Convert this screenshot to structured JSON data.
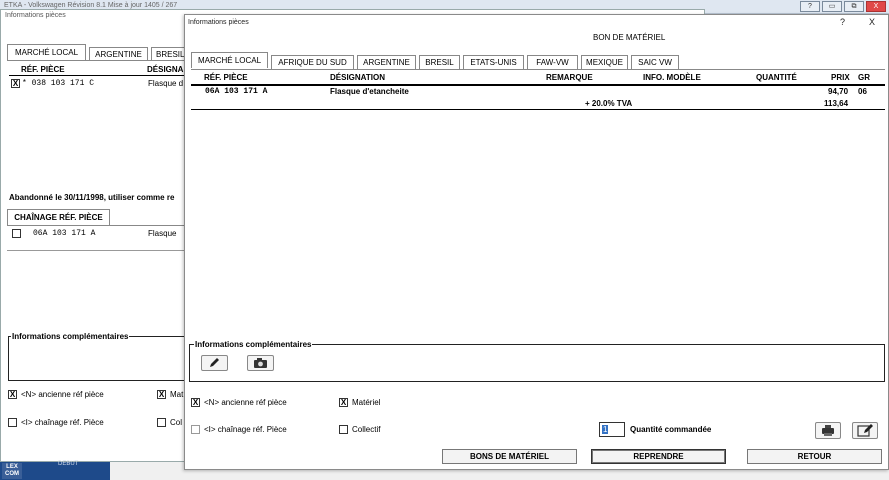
{
  "app": {
    "title": "ETKA - Volkswagen Révision 8.1 Mise à jour 1405 / 267",
    "controls": [
      "?",
      "▭",
      "⧉",
      "X"
    ],
    "logo": "LEX COM",
    "taskbar_label": "DEBUT"
  },
  "back_window": {
    "title": "Informations pièces",
    "tabs": [
      "MARCHÉ LOCAL",
      "ARGENTINE",
      "BRESIL"
    ],
    "columns": [
      "RÉF. PIÈCE",
      "DÉSIGNA"
    ],
    "row": {
      "mark": "X",
      "ref": "* 038 103 171 C",
      "designation": "Flasque d"
    },
    "abandon_text": "Abandonné le 30/11/1998, utiliser comme re",
    "chain_tab": "CHAÎNAGE RÉF. PIÈCE",
    "chain_row": {
      "ref": "06A 103 171 A",
      "designation": "Flasque"
    },
    "info_complementaires": "Informations complémentaires",
    "opt_old_ref": "<N> ancienne réf pièce",
    "opt_old_ref_checked": "X",
    "opt_material": "Mat",
    "opt_material_checked": "X",
    "opt_chain": "<I> chaînage réf. Pièce",
    "opt_collectif": "Col"
  },
  "dialog": {
    "title": "Informations pièces",
    "help": "?",
    "close": "X",
    "heading": "BON DE MATÉRIEL",
    "tabs": [
      "MARCHÉ LOCAL",
      "AFRIQUE DU SUD",
      "ARGENTINE",
      "BRESIL",
      "ETATS-UNIS",
      "FAW-VW",
      "MEXIQUE",
      "SAIC VW"
    ],
    "columns": {
      "ref": "RÉF. PIÈCE",
      "designation": "DÉSIGNATION",
      "remark": "REMARQUE",
      "model_info": "INFO. MODÈLE",
      "quantity": "QUANTITÉ",
      "price": "PRIX",
      "gr": "GR"
    },
    "row": {
      "ref": "06A 103 171 A",
      "designation": "Flasque d'etancheite",
      "price": "94,70",
      "gr": "06"
    },
    "tva_label": "+ 20.0% TVA",
    "tva_price": "113,64",
    "info_complementaires": "Informations complémentaires",
    "opt_old_ref": "<N> ancienne réf pièce",
    "opt_old_ref_checked": "X",
    "opt_chain": "<I> chaînage réf. Pièce",
    "opt_material": "Matériel",
    "opt_material_checked": "X",
    "opt_collectif": "Collectif",
    "quantity_value": "1",
    "quantity_label": "Quantité commandée",
    "buttons": {
      "bons": "BONS DE MATÉRIEL",
      "reprendre": "REPRENDRE",
      "retour": "RETOUR"
    }
  }
}
